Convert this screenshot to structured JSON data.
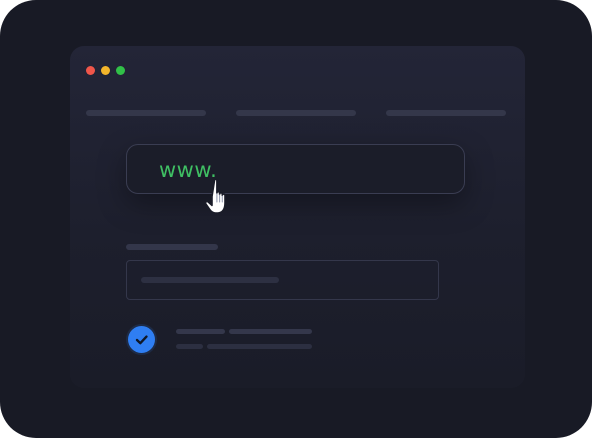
{
  "window": {
    "controls": [
      {
        "name": "close",
        "color": "#f0564a"
      },
      {
        "name": "minimize",
        "color": "#f3b52b"
      },
      {
        "name": "maximize",
        "color": "#31c048"
      }
    ]
  },
  "url_field": {
    "value": "www."
  },
  "icons": {
    "cursor": "hand-pointer-icon",
    "check": "checkmark-icon"
  },
  "colors": {
    "url_text": "#3fbf63",
    "check_badge": "#2f7ef2",
    "background": "#181a25"
  }
}
